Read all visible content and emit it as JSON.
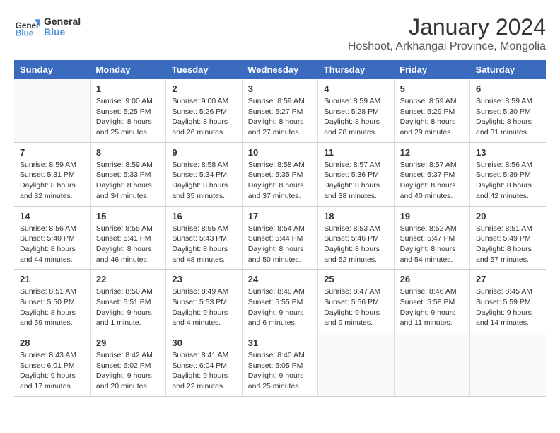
{
  "logo": {
    "line1": "General",
    "line2": "Blue"
  },
  "title": "January 2024",
  "subtitle": "Hoshoot, Arkhangai Province, Mongolia",
  "days_of_week": [
    "Sunday",
    "Monday",
    "Tuesday",
    "Wednesday",
    "Thursday",
    "Friday",
    "Saturday"
  ],
  "weeks": [
    [
      {
        "day": "",
        "info": ""
      },
      {
        "day": "1",
        "info": "Sunrise: 9:00 AM\nSunset: 5:25 PM\nDaylight: 8 hours\nand 25 minutes."
      },
      {
        "day": "2",
        "info": "Sunrise: 9:00 AM\nSunset: 5:26 PM\nDaylight: 8 hours\nand 26 minutes."
      },
      {
        "day": "3",
        "info": "Sunrise: 8:59 AM\nSunset: 5:27 PM\nDaylight: 8 hours\nand 27 minutes."
      },
      {
        "day": "4",
        "info": "Sunrise: 8:59 AM\nSunset: 5:28 PM\nDaylight: 8 hours\nand 28 minutes."
      },
      {
        "day": "5",
        "info": "Sunrise: 8:59 AM\nSunset: 5:29 PM\nDaylight: 8 hours\nand 29 minutes."
      },
      {
        "day": "6",
        "info": "Sunrise: 8:59 AM\nSunset: 5:30 PM\nDaylight: 8 hours\nand 31 minutes."
      }
    ],
    [
      {
        "day": "7",
        "info": "Sunrise: 8:59 AM\nSunset: 5:31 PM\nDaylight: 8 hours\nand 32 minutes."
      },
      {
        "day": "8",
        "info": "Sunrise: 8:59 AM\nSunset: 5:33 PM\nDaylight: 8 hours\nand 34 minutes."
      },
      {
        "day": "9",
        "info": "Sunrise: 8:58 AM\nSunset: 5:34 PM\nDaylight: 8 hours\nand 35 minutes."
      },
      {
        "day": "10",
        "info": "Sunrise: 8:58 AM\nSunset: 5:35 PM\nDaylight: 8 hours\nand 37 minutes."
      },
      {
        "day": "11",
        "info": "Sunrise: 8:57 AM\nSunset: 5:36 PM\nDaylight: 8 hours\nand 38 minutes."
      },
      {
        "day": "12",
        "info": "Sunrise: 8:57 AM\nSunset: 5:37 PM\nDaylight: 8 hours\nand 40 minutes."
      },
      {
        "day": "13",
        "info": "Sunrise: 8:56 AM\nSunset: 5:39 PM\nDaylight: 8 hours\nand 42 minutes."
      }
    ],
    [
      {
        "day": "14",
        "info": "Sunrise: 8:56 AM\nSunset: 5:40 PM\nDaylight: 8 hours\nand 44 minutes."
      },
      {
        "day": "15",
        "info": "Sunrise: 8:55 AM\nSunset: 5:41 PM\nDaylight: 8 hours\nand 46 minutes."
      },
      {
        "day": "16",
        "info": "Sunrise: 8:55 AM\nSunset: 5:43 PM\nDaylight: 8 hours\nand 48 minutes."
      },
      {
        "day": "17",
        "info": "Sunrise: 8:54 AM\nSunset: 5:44 PM\nDaylight: 8 hours\nand 50 minutes."
      },
      {
        "day": "18",
        "info": "Sunrise: 8:53 AM\nSunset: 5:46 PM\nDaylight: 8 hours\nand 52 minutes."
      },
      {
        "day": "19",
        "info": "Sunrise: 8:52 AM\nSunset: 5:47 PM\nDaylight: 8 hours\nand 54 minutes."
      },
      {
        "day": "20",
        "info": "Sunrise: 8:51 AM\nSunset: 5:49 PM\nDaylight: 8 hours\nand 57 minutes."
      }
    ],
    [
      {
        "day": "21",
        "info": "Sunrise: 8:51 AM\nSunset: 5:50 PM\nDaylight: 8 hours\nand 59 minutes."
      },
      {
        "day": "22",
        "info": "Sunrise: 8:50 AM\nSunset: 5:51 PM\nDaylight: 9 hours\nand 1 minute."
      },
      {
        "day": "23",
        "info": "Sunrise: 8:49 AM\nSunset: 5:53 PM\nDaylight: 9 hours\nand 4 minutes."
      },
      {
        "day": "24",
        "info": "Sunrise: 8:48 AM\nSunset: 5:55 PM\nDaylight: 9 hours\nand 6 minutes."
      },
      {
        "day": "25",
        "info": "Sunrise: 8:47 AM\nSunset: 5:56 PM\nDaylight: 9 hours\nand 9 minutes."
      },
      {
        "day": "26",
        "info": "Sunrise: 8:46 AM\nSunset: 5:58 PM\nDaylight: 9 hours\nand 11 minutes."
      },
      {
        "day": "27",
        "info": "Sunrise: 8:45 AM\nSunset: 5:59 PM\nDaylight: 9 hours\nand 14 minutes."
      }
    ],
    [
      {
        "day": "28",
        "info": "Sunrise: 8:43 AM\nSunset: 6:01 PM\nDaylight: 9 hours\nand 17 minutes."
      },
      {
        "day": "29",
        "info": "Sunrise: 8:42 AM\nSunset: 6:02 PM\nDaylight: 9 hours\nand 20 minutes."
      },
      {
        "day": "30",
        "info": "Sunrise: 8:41 AM\nSunset: 6:04 PM\nDaylight: 9 hours\nand 22 minutes."
      },
      {
        "day": "31",
        "info": "Sunrise: 8:40 AM\nSunset: 6:05 PM\nDaylight: 9 hours\nand 25 minutes."
      },
      {
        "day": "",
        "info": ""
      },
      {
        "day": "",
        "info": ""
      },
      {
        "day": "",
        "info": ""
      }
    ]
  ]
}
